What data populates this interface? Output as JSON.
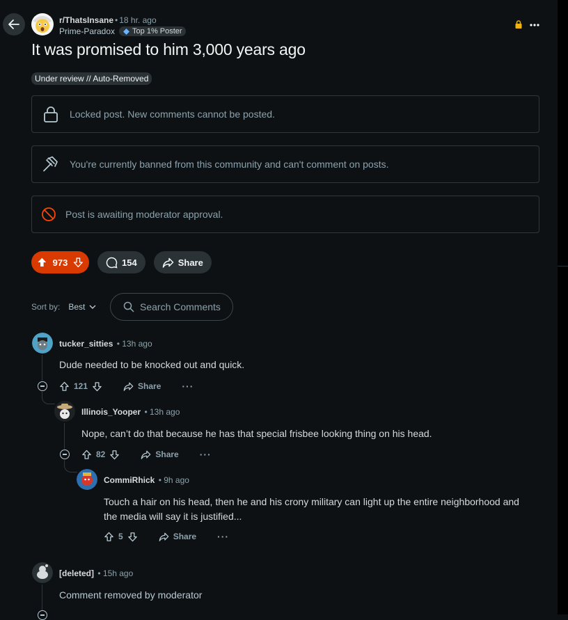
{
  "post": {
    "subreddit": "r/ThatsInsane",
    "time": "18 hr. ago",
    "author": "Prime-Paradox",
    "author_flair": "Top 1% Poster",
    "title": "It was promised to him 3,000 years ago",
    "status_flair": "Under review // Auto-Removed",
    "notices": {
      "locked": "Locked post. New comments cannot be posted.",
      "banned": "You're currently banned from this community and can't comment on posts.",
      "awaiting": "Post is awaiting moderator approval."
    },
    "votes": "973",
    "comments_count": "154",
    "share_label": "Share"
  },
  "sort": {
    "label": "Sort by:",
    "value": "Best"
  },
  "search": {
    "placeholder": "Search Comments"
  },
  "comments": [
    {
      "author": "tucker_sitties",
      "time": "13h ago",
      "body": "Dude needed to be knocked out and quick.",
      "votes": "121",
      "share": "Share"
    },
    {
      "author": "Illinois_Yooper",
      "time": "13h ago",
      "body": "Nope, can’t do that because he has that special frisbee looking thing on his head.",
      "votes": "82",
      "share": "Share"
    },
    {
      "author": "CommiRhick",
      "time": "9h ago",
      "body_line1": "Touch a hair on his head, then he and his crony military can light up the entire neighborhood and",
      "body_line2": "the media will say it is justified...",
      "votes": "5",
      "share": "Share"
    },
    {
      "author": "[deleted]",
      "time": "15h ago",
      "body": "Comment removed by moderator"
    }
  ],
  "colors": {
    "background": "#0e1113",
    "upvote_active": "#d93a00",
    "pill": "#2a3236"
  }
}
